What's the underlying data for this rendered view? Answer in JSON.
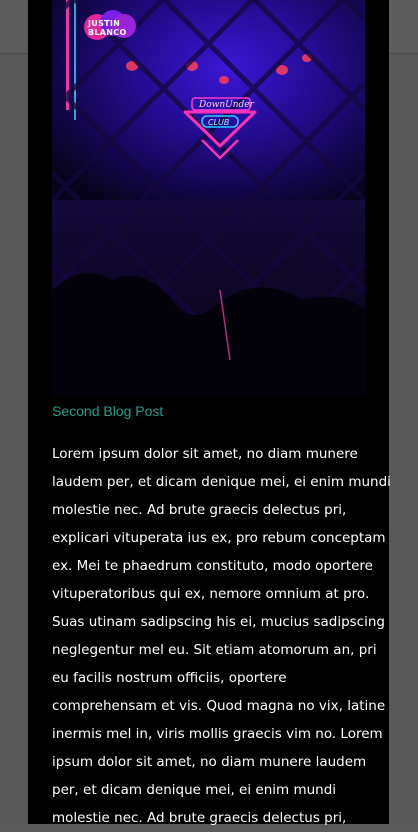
{
  "header": {
    "logo_line1": "JUSTIN",
    "logo_line2": "BLANCO",
    "menu_icon": "hamburger-icon"
  },
  "hero": {
    "sign_line1": "DownUnder",
    "sign_line2": "CLUB"
  },
  "post": {
    "title": "Second Blog Post",
    "body_lines": [
      "Lorem ipsum dolor sit amet, no diam munere",
      "laudem per, et dicam denique mei, ei enim mundi",
      "molestie nec. Ad brute graecis delectus pri,",
      "explicari vituperata ius ex, pro rebum conceptam",
      "ex. Mei te phaedrum constituto, modo oportere",
      "vituperatoribus qui ex, nemore omnium at pro.",
      "Suas utinam sadipscing his ei, mucius sadipscing",
      "neglegentur mel eu. Sit etiam atomorum an, pri",
      "eu facilis nostrum officiis, oportere",
      "comprehensam et vis. Quod magna no vix, latine",
      "inermis mel in, viris mollis graecis vim no. Lorem",
      "ipsum dolor sit amet, no diam munere laudem",
      "per, et dicam denique mei, ei enim mundi",
      "molestie nec. Ad brute graecis delectus pri,"
    ]
  },
  "colors": {
    "title_accent": "#1e9e8f",
    "panel_background": "#000000",
    "page_background": "#585858",
    "logo_pink": "#e0279a",
    "logo_purple": "#7a1fe8"
  }
}
